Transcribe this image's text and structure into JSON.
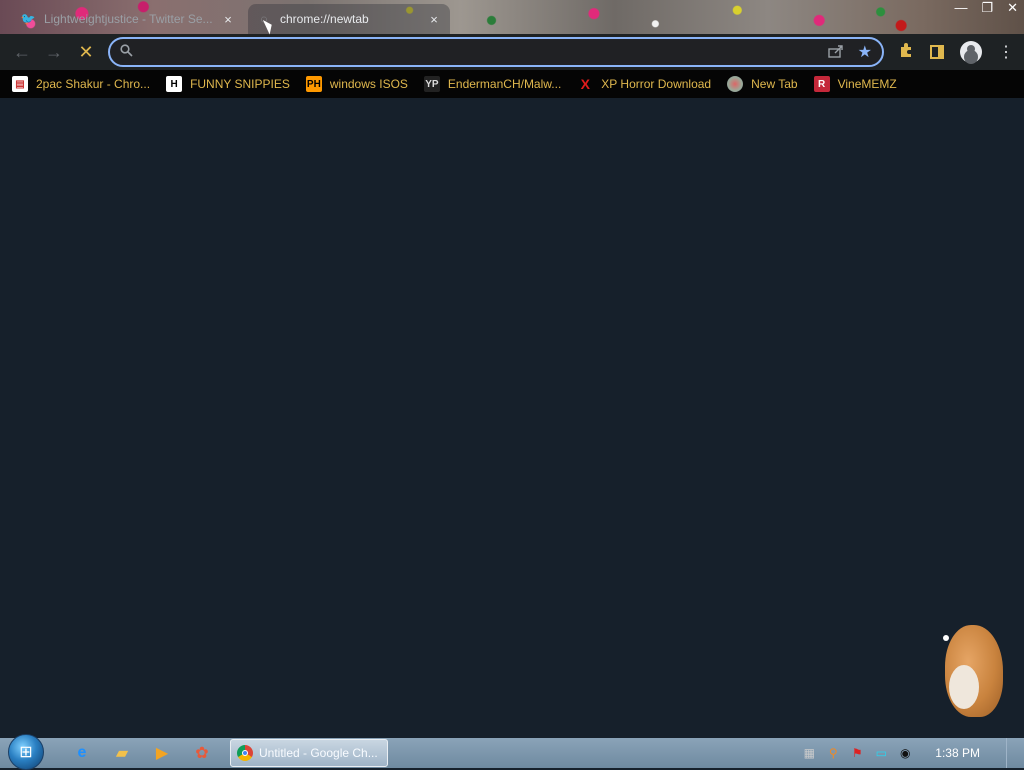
{
  "browser": {
    "tabs": [
      {
        "title": "Lightweightjustice - Twitter Se...",
        "icon": "twitter-icon",
        "close": "×"
      },
      {
        "title": "chrome://newtab",
        "icon": "loading-icon",
        "close": "×"
      }
    ],
    "window_controls": {
      "minimize": "—",
      "maximize": "❐",
      "close": "✕"
    },
    "toolbar": {
      "back": "←",
      "forward": "→",
      "stop": "✕",
      "omnibox": {
        "value": "",
        "placeholder": ""
      },
      "icons": [
        "search-icon",
        "share-icon",
        "star-icon",
        "extensions-icon",
        "side-panel-icon",
        "profile-icon",
        "menu-icon"
      ],
      "menu": "⋮"
    },
    "bookmarks": [
      {
        "label": "2pac Shakur - Chro...",
        "icon": "chrome-store-icon"
      },
      {
        "label": "FUNNY SNIPPIES",
        "icon": "H"
      },
      {
        "label": "windows ISOS",
        "icon": "PH"
      },
      {
        "label": "EndermanCH/Malw...",
        "icon": "YP"
      },
      {
        "label": "XP Horror Download",
        "icon": "X"
      },
      {
        "label": "New Tab",
        "icon": "globe-icon"
      },
      {
        "label": "VineMEMZ",
        "icon": "R"
      }
    ]
  },
  "taskbar": {
    "active_window": "Untitled - Google Ch...",
    "clock": "1:38 PM",
    "pinned": [
      "internet-explorer-icon",
      "explorer-icon",
      "media-player-icon",
      "paint-icon"
    ],
    "tray_icons": [
      "network-icon",
      "search-tray-icon",
      "flag-icon",
      "display-icon",
      "volume-icon"
    ]
  },
  "colors": {
    "accent": "#8ab4f8",
    "bookmark_text": "#e0b84e",
    "page_bg": "#16202b"
  }
}
